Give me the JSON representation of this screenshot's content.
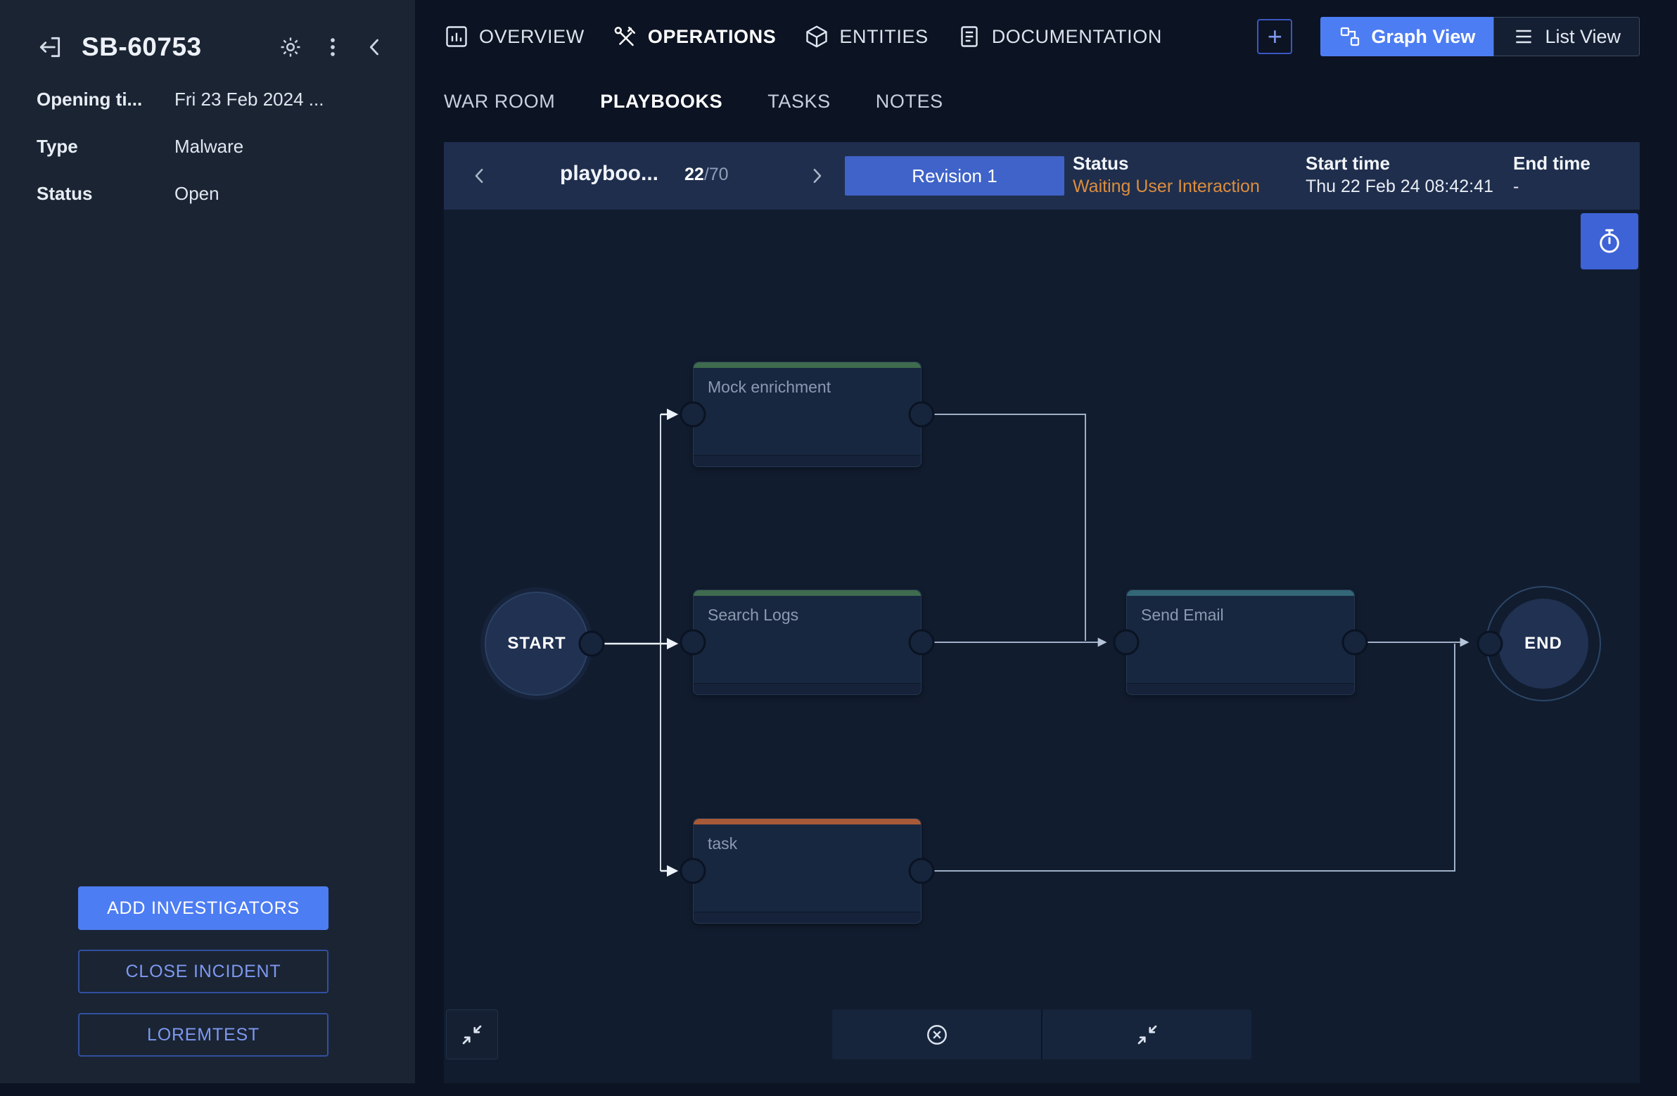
{
  "colors": {
    "accent_blue": "#4d7df2",
    "revision_blue": "#3f63c8",
    "status_orange": "#dc8e3e",
    "edge": "#9fb0c8",
    "node_green": "#3f6b4e",
    "node_rust": "#a85a38",
    "node_teal": "#336777"
  },
  "icons": {
    "back": "back-arrow-icon",
    "settings": "gear-icon",
    "more": "kebab-menu-icon",
    "collapse_sidebar": "chevron-left-icon",
    "overview": "bar-chart-icon",
    "operations": "tools-icon",
    "entities": "cube-icon",
    "documentation": "document-icon",
    "add_tab": "plus-icon",
    "graph_view": "flowchart-icon",
    "list_view": "list-icon",
    "prev": "chevron-left-icon",
    "next": "chevron-right-icon",
    "timer": "timer-icon",
    "fit_view": "compress-icon",
    "close_circle": "circle-x-icon"
  },
  "sidebar": {
    "incident_id": "SB-60753",
    "fields": [
      {
        "label": "Opening ti...",
        "value": "Fri 23 Feb 2024 ..."
      },
      {
        "label": "Type",
        "value": "Malware"
      },
      {
        "label": "Status",
        "value": "Open"
      }
    ],
    "actions": {
      "add_investigators": "ADD INVESTIGATORS",
      "close_incident": "CLOSE INCIDENT",
      "loremtest": "LOREMTEST"
    }
  },
  "topbar": {
    "tabs": [
      {
        "label": "OVERVIEW"
      },
      {
        "label": "OPERATIONS"
      },
      {
        "label": "ENTITIES"
      },
      {
        "label": "DOCUMENTATION"
      }
    ],
    "add_tab_label": "+",
    "graph_view_label": "Graph View",
    "list_view_label": "List View"
  },
  "subtabs": [
    {
      "label": "WAR ROOM"
    },
    {
      "label": "PLAYBOOKS"
    },
    {
      "label": "TASKS"
    },
    {
      "label": "NOTES"
    }
  ],
  "playbook_bar": {
    "title": "playboo...",
    "counter": {
      "current": "22",
      "total": "/70"
    },
    "revision_label": "Revision 1",
    "status_label": "Status",
    "status_value": "Waiting User Interaction",
    "start_label": "Start time",
    "start_value": "Thu 22 Feb 24 08:42:41",
    "end_label": "End time",
    "end_value": "-"
  },
  "graph": {
    "start_label": "START",
    "end_label": "END",
    "nodes": [
      {
        "label": "Mock enrichment",
        "accent": "#3f6b4e"
      },
      {
        "label": "Search Logs",
        "accent": "#3f6b4e"
      },
      {
        "label": "task",
        "accent": "#a85a38"
      },
      {
        "label": "Send Email",
        "accent": "#336777"
      }
    ]
  }
}
